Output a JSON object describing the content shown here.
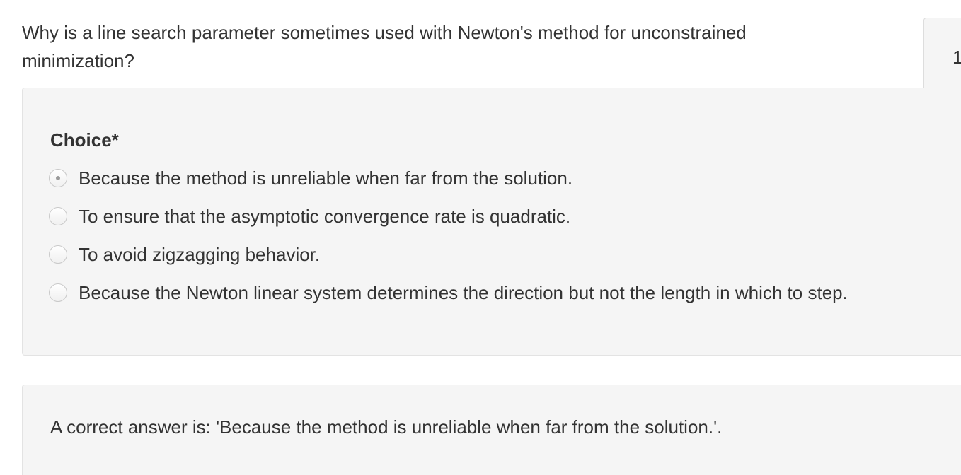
{
  "question": {
    "text": "Why is a line search parameter sometimes used with Newton's method for unconstrained minimization?",
    "number": "1"
  },
  "choice": {
    "label": "Choice*",
    "selected_index": 0,
    "options": [
      {
        "label": "Because the method is unreliable when far from the solution.",
        "checked": true
      },
      {
        "label": "To ensure that the asymptotic convergence rate is quadratic.",
        "checked": false
      },
      {
        "label": "To avoid zigzagging behavior.",
        "checked": false
      },
      {
        "label": "Because the Newton linear system determines the direction but not the length in which to step.",
        "checked": false
      }
    ]
  },
  "feedback": {
    "text": "A correct answer is: 'Because the method is unreliable when far from the solution.'."
  }
}
